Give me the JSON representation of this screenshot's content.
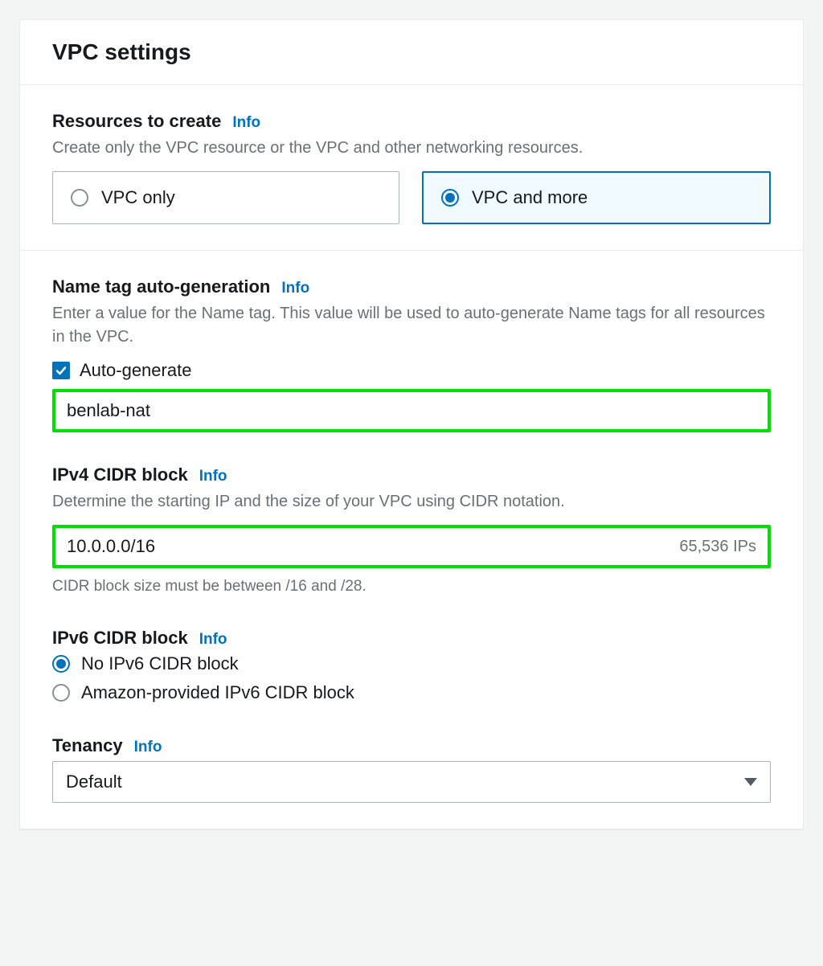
{
  "panel": {
    "title": "VPC settings"
  },
  "info_label": "Info",
  "resources": {
    "label": "Resources to create",
    "help": "Create only the VPC resource or the VPC and other networking resources.",
    "options": [
      {
        "label": "VPC only",
        "selected": false
      },
      {
        "label": "VPC and more",
        "selected": true
      }
    ]
  },
  "name_tag": {
    "label": "Name tag auto-generation",
    "help": "Enter a value for the Name tag. This value will be used to auto-generate Name tags for all resources in the VPC.",
    "checkbox_label": "Auto-generate",
    "checked": true,
    "value": "benlab-nat"
  },
  "ipv4": {
    "label": "IPv4 CIDR block",
    "help": "Determine the starting IP and the size of your VPC using CIDR notation.",
    "value": "10.0.0.0/16",
    "ips_hint": "65,536 IPs",
    "constraint": "CIDR block size must be between /16 and /28."
  },
  "ipv6": {
    "label": "IPv6 CIDR block",
    "options": [
      {
        "label": "No IPv6 CIDR block",
        "selected": true
      },
      {
        "label": "Amazon-provided IPv6 CIDR block",
        "selected": false
      }
    ]
  },
  "tenancy": {
    "label": "Tenancy",
    "value": "Default"
  }
}
